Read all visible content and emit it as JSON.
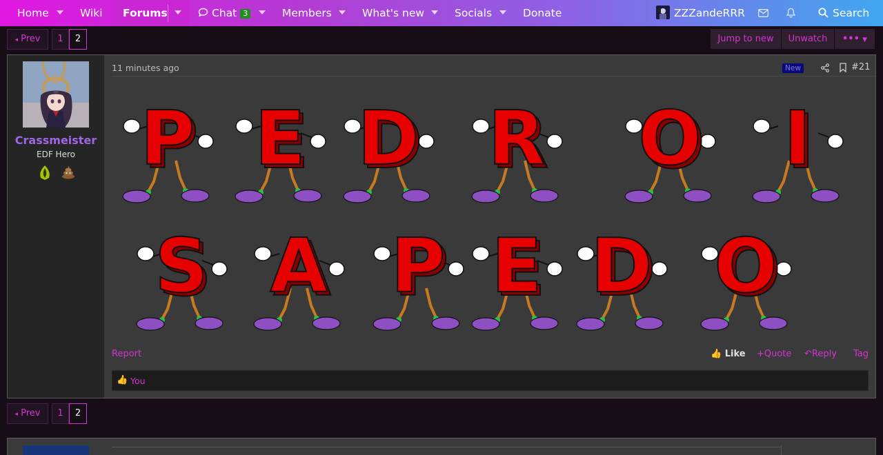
{
  "nav": {
    "home": "Home",
    "wiki": "Wiki",
    "forums": "Forums",
    "chat": "Chat",
    "chat_count": "3",
    "members": "Members",
    "whats_new": "What's new",
    "socials": "Socials",
    "donate": "Donate",
    "username": "ZZZandeRRR",
    "search": "Search"
  },
  "pagination": {
    "prev": "Prev",
    "pages": [
      "1",
      "2"
    ],
    "current": "2"
  },
  "thread_tools": {
    "jump_to_new": "Jump to new",
    "unwatch": "Unwatch",
    "more": "•••"
  },
  "post": {
    "author": "Crassmeister",
    "user_title": "EDF Hero",
    "timestamp": "11 minutes ago",
    "new_badge": "New",
    "post_number": "#21",
    "image_letters": {
      "row1": [
        "P",
        "E",
        "D",
        "R",
        "O",
        "I"
      ],
      "row2": [
        "S",
        "A",
        "P",
        "E",
        "D",
        "O"
      ]
    },
    "report": "Report",
    "like": "Like",
    "quote": "Quote",
    "reply": "Reply",
    "tag": "Tag",
    "reactions_user": "You"
  },
  "colors": {
    "accent": "#d236d2",
    "username": "#9f67e8",
    "letter_red": "#e60000",
    "shoe_purple": "#8d4fc2"
  }
}
